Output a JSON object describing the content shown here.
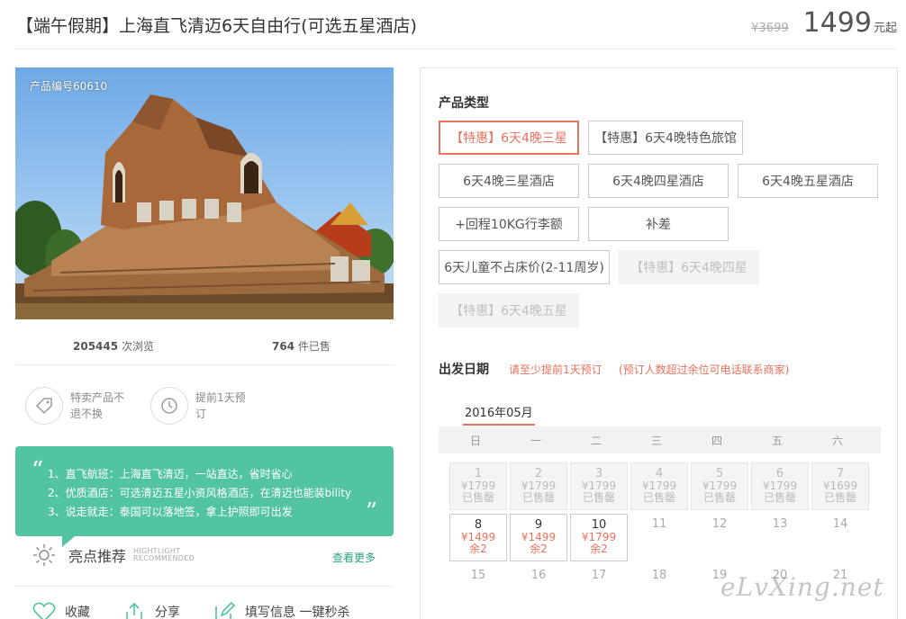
{
  "header": {
    "title": "【端午假期】上海直飞清迈6天自由行(可选五星酒店)",
    "original_price": "¥3699",
    "price": "1499",
    "price_suffix": "元起"
  },
  "photo": {
    "product_code": "产品编号60610"
  },
  "stats": {
    "views": "205445",
    "views_label": "次浏览",
    "sold": "764",
    "sold_label": "件已售"
  },
  "features": [
    {
      "icon": "tag-icon",
      "text": "特卖产品不退不换"
    },
    {
      "icon": "clock-icon",
      "text": "提前1天预订"
    }
  ],
  "highlights": {
    "lines": [
      "1、直飞航班：上海直飞清迈，一站直达，省时省心",
      "2、优质酒店：可选清迈五星小资风格酒店，在清迈也能装bility",
      "3、说走就走：泰国可以落地签，拿上护照即可出发"
    ],
    "title": "亮点推荐",
    "sub1": "HIGHTLIGHT",
    "sub2": "RECOMMENDED",
    "more": "查看更多"
  },
  "actions": [
    {
      "icon": "heart-icon",
      "label": "收藏"
    },
    {
      "icon": "share-icon",
      "label": "分享"
    },
    {
      "icon": "edit-icon",
      "label": "填写信息 一键秒杀"
    }
  ],
  "product_type": {
    "title": "产品类型",
    "options": [
      {
        "label": "【特惠】6天4晚三星",
        "state": "selected"
      },
      {
        "label": "【特惠】6天4晚特色旅馆",
        "state": "normal"
      },
      {
        "label": "6天4晚三星酒店",
        "state": "normal"
      },
      {
        "label": "6天4晚四星酒店",
        "state": "normal"
      },
      {
        "label": "6天4晚五星酒店",
        "state": "normal"
      },
      {
        "label": "+回程10KG行李额",
        "state": "normal"
      },
      {
        "label": "补差",
        "state": "normal"
      },
      {
        "label": "6天儿童不占床价(2-11周岁)",
        "state": "normal"
      },
      {
        "label": "【特惠】6天4晚四星",
        "state": "disabled"
      },
      {
        "label": "【特惠】6天4晚五星",
        "state": "disabled"
      }
    ]
  },
  "departure": {
    "title": "出发日期",
    "note1": "请至少提前1天预订",
    "note2": "(预订人数超过余位可电话联系商家)",
    "month": "2016年05月",
    "weekdays": [
      "日",
      "一",
      "二",
      "三",
      "四",
      "五",
      "六"
    ],
    "days": [
      {
        "day": "1",
        "price": "¥1799",
        "status": "已售罄",
        "state": "sold"
      },
      {
        "day": "2",
        "price": "¥1799",
        "status": "已售罄",
        "state": "sold"
      },
      {
        "day": "3",
        "price": "¥1799",
        "status": "已售罄",
        "state": "sold"
      },
      {
        "day": "4",
        "price": "¥1799",
        "status": "已售罄",
        "state": "sold"
      },
      {
        "day": "5",
        "price": "¥1799",
        "status": "已售罄",
        "state": "sold"
      },
      {
        "day": "6",
        "price": "¥1799",
        "status": "已售罄",
        "state": "sold"
      },
      {
        "day": "7",
        "price": "¥1699",
        "status": "已售罄",
        "state": "sold"
      },
      {
        "day": "8",
        "price": "¥1499",
        "status": "余2",
        "state": "avail"
      },
      {
        "day": "9",
        "price": "¥1499",
        "status": "余2",
        "state": "avail"
      },
      {
        "day": "10",
        "price": "¥1799",
        "status": "余2",
        "state": "avail"
      },
      {
        "day": "11",
        "price": "",
        "status": "",
        "state": "plain"
      },
      {
        "day": "12",
        "price": "",
        "status": "",
        "state": "plain"
      },
      {
        "day": "13",
        "price": "",
        "status": "",
        "state": "plain"
      },
      {
        "day": "14",
        "price": "",
        "status": "",
        "state": "plain"
      },
      {
        "day": "15",
        "price": "",
        "status": "",
        "state": "plain"
      },
      {
        "day": "16",
        "price": "",
        "status": "",
        "state": "plain"
      },
      {
        "day": "17",
        "price": "",
        "status": "",
        "state": "plain"
      },
      {
        "day": "18",
        "price": "",
        "status": "",
        "state": "plain"
      },
      {
        "day": "19",
        "price": "",
        "status": "",
        "state": "plain"
      },
      {
        "day": "20",
        "price": "",
        "status": "",
        "state": "plain"
      },
      {
        "day": "21",
        "price": "",
        "status": "",
        "state": "plain"
      }
    ]
  },
  "watermark": "eLvXing.net",
  "colors": {
    "accent": "#e8725e",
    "highlight_bg": "#52c3a3",
    "link": "#2aa27f"
  }
}
